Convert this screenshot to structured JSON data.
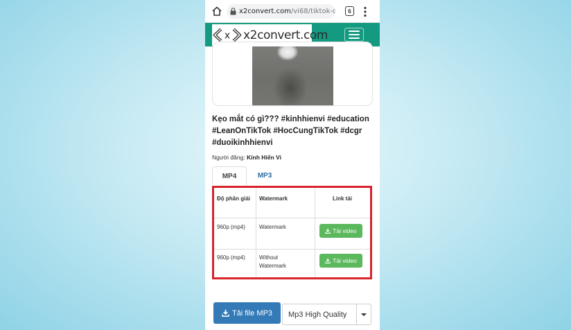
{
  "browser": {
    "url_host": "x2convert.com",
    "url_path": "/vi68/tiktok-d",
    "tabs_count": "6",
    "icons": {
      "home": "home-icon",
      "lock": "lock-icon",
      "menu": "more-vert-icon"
    }
  },
  "site": {
    "logo_mark": "x",
    "logo_text": "x2convert.com",
    "header_color": "#149a80",
    "menu_icon": "hamburger-menu-icon"
  },
  "video": {
    "title": "Kẹo mắt có gì??? #kinhhienvi #education #LeanOnTikTok #HocCungTikTok #dcgr #duoikinhhienvi",
    "poster_label": "Người đăng:",
    "poster_name": "Kính Hiển Vi"
  },
  "format_tabs": [
    {
      "label": "MP4",
      "active": true
    },
    {
      "label": "MP3",
      "active": false
    }
  ],
  "table": {
    "headers": [
      "Độ phân giải",
      "Watermark",
      "Link tải"
    ],
    "rows": [
      {
        "resolution": "960p (mp4)",
        "watermark": "Watermark",
        "button": "Tải video"
      },
      {
        "resolution": "960p (mp4)",
        "watermark": "Without Watermark",
        "button": "Tải video"
      }
    ],
    "highlight_color": "#d8242b",
    "button_color": "#5cb85c"
  },
  "bottom": {
    "mp3_button": "Tải file MP3",
    "quality_select": "Mp3 High Quality",
    "button_color": "#337ab7"
  }
}
